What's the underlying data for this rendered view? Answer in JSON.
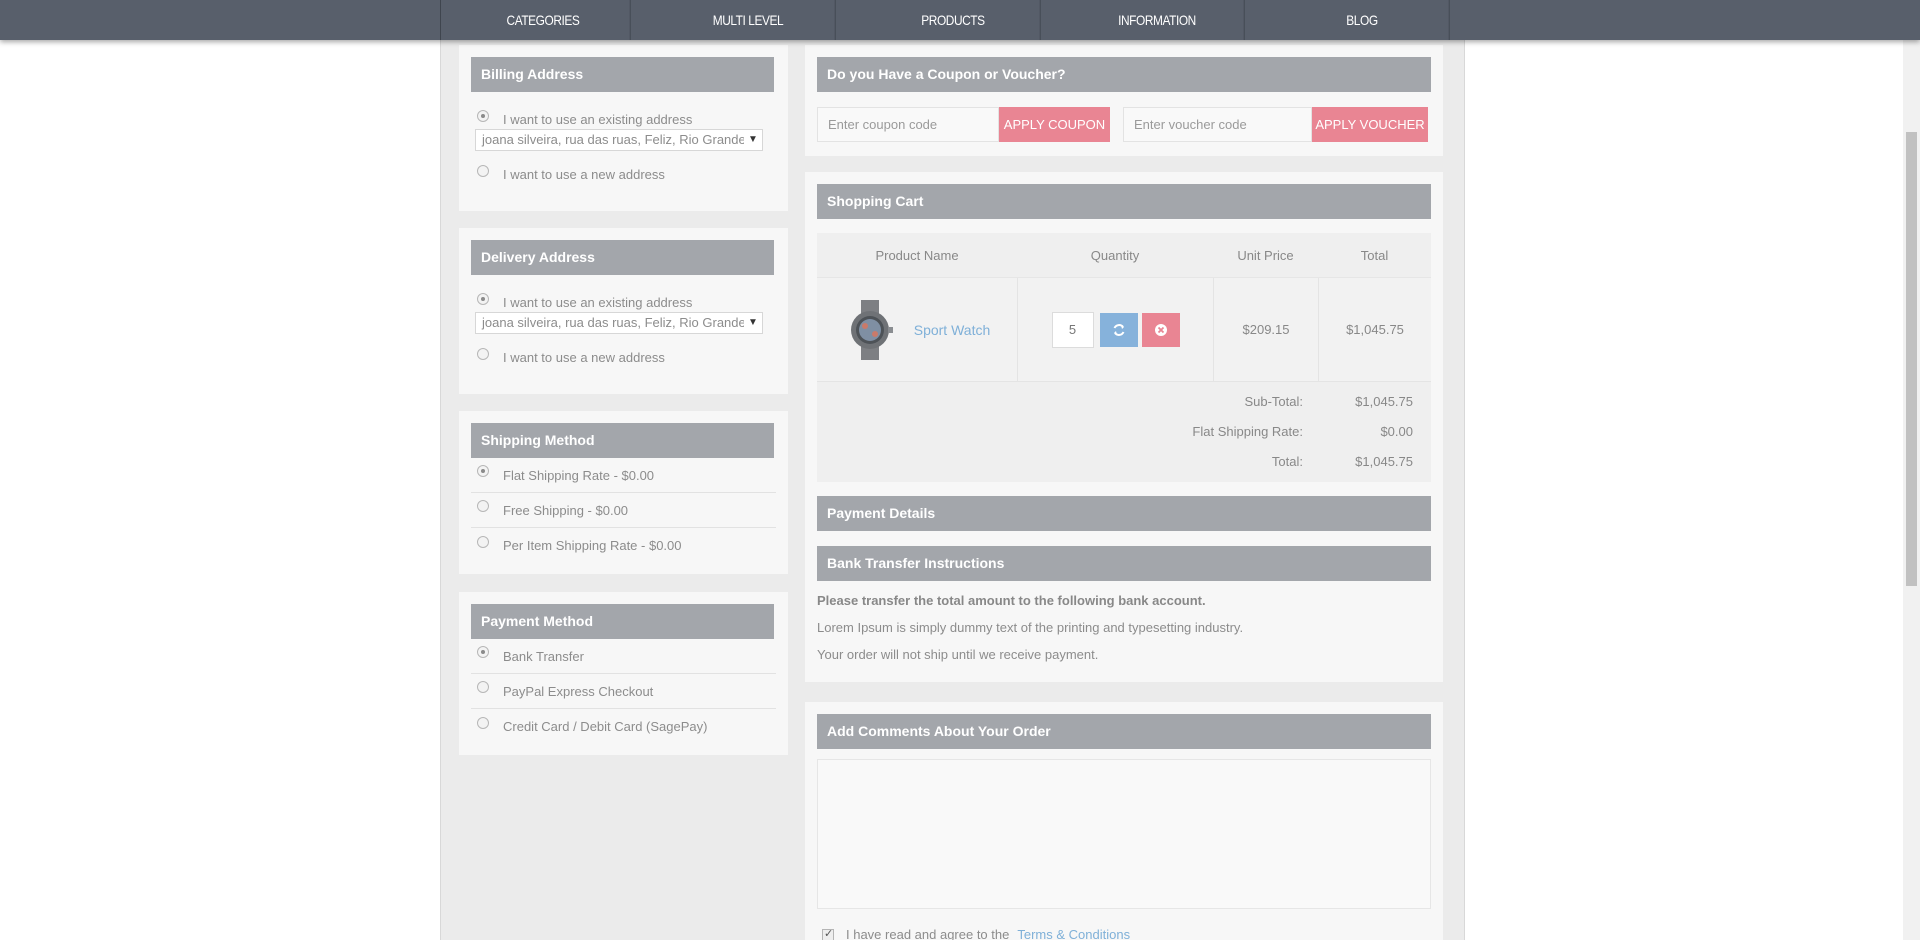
{
  "nav": {
    "items": [
      "CATEGORIES",
      "MULTI LEVEL",
      "PRODUCTS",
      "INFORMATION",
      "BLOG"
    ]
  },
  "billing": {
    "heading": "Billing Address",
    "existing_label": "I want to use an existing address",
    "address_value": "joana silveira, rua das ruas, Feliz, Rio Grande",
    "new_label": "I want to use a new address"
  },
  "delivery": {
    "heading": "Delivery Address",
    "existing_label": "I want to use an existing address",
    "address_value": "joana silveira, rua das ruas, Feliz, Rio Grande",
    "new_label": "I want to use a new address"
  },
  "shipping": {
    "heading": "Shipping Method",
    "options": [
      "Flat Shipping Rate - $0.00",
      "Free Shipping - $0.00",
      "Per Item Shipping Rate - $0.00"
    ]
  },
  "payment": {
    "heading": "Payment Method",
    "options": [
      "Bank Transfer",
      "PayPal Express Checkout",
      "Credit Card / Debit Card (SagePay)"
    ]
  },
  "coupon": {
    "heading": "Do you Have a Coupon or Voucher?",
    "coupon_placeholder": "Enter coupon code",
    "coupon_button": "APPLY COUPON",
    "voucher_placeholder": "Enter voucher code",
    "voucher_button": "APPLY VOUCHER"
  },
  "cart": {
    "heading": "Shopping Cart",
    "columns": [
      "Product Name",
      "Quantity",
      "Unit Price",
      "Total"
    ],
    "item": {
      "name": "Sport Watch",
      "quantity": "5",
      "unit_price": "$209.15",
      "total": "$1,045.75"
    },
    "totals": [
      {
        "label": "Sub-Total:",
        "value": "$1,045.75"
      },
      {
        "label": "Flat Shipping Rate:",
        "value": "$0.00"
      },
      {
        "label": "Total:",
        "value": "$1,045.75"
      }
    ]
  },
  "payment_details": {
    "heading": "Payment Details",
    "bank_heading": "Bank Transfer Instructions",
    "bank_bold": "Please transfer the total amount to the following bank account.",
    "bank_text": "Lorem Ipsum is simply dummy text of the printing and typesetting industry.",
    "bank_note": "Your order will not ship until we receive payment."
  },
  "comments": {
    "heading": "Add Comments About Your Order",
    "terms_text": "I have read and agree to the",
    "terms_link": "Terms & Conditions"
  }
}
